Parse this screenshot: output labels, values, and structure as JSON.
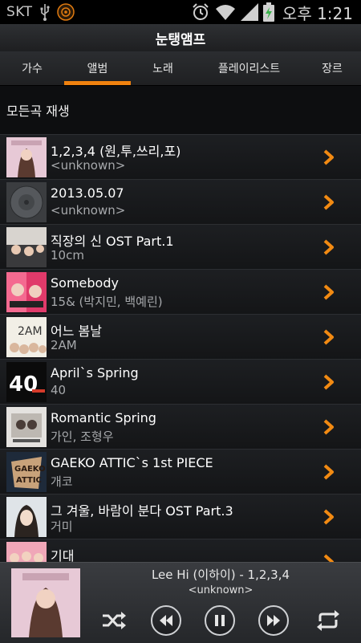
{
  "status_bar": {
    "carrier": "SKT",
    "time": "오후 1:21"
  },
  "app": {
    "title": "눈탱앰프"
  },
  "tabs": [
    {
      "label": "가수"
    },
    {
      "label": "앨범",
      "selected": true
    },
    {
      "label": "노래"
    },
    {
      "label": "플레이리스트"
    },
    {
      "label": "장르"
    }
  ],
  "play_all": {
    "label": "모든곡 재생"
  },
  "albums": [
    {
      "title": "1,2,3,4 (원,투,쓰리,포)",
      "artist": "<unknown>"
    },
    {
      "title": "2013.05.07",
      "artist": "<unknown>"
    },
    {
      "title": "직장의 신 OST Part.1",
      "artist": "10cm"
    },
    {
      "title": "Somebody",
      "artist": "15& (박지민, 백예린)"
    },
    {
      "title": "어느 봄날",
      "artist": "2AM"
    },
    {
      "title": "April`s Spring",
      "artist": "40"
    },
    {
      "title": "Romantic Spring",
      "artist": "가인, 조형우"
    },
    {
      "title": "GAEKO ATTIC`s 1st PIECE",
      "artist": "개코"
    },
    {
      "title": "그 겨울, 바람이 분다 OST Part.3",
      "artist": "거미"
    },
    {
      "title": "기대",
      "artist": ""
    }
  ],
  "now_playing": {
    "title": "Lee Hi (이하이) - 1,2,3,4",
    "artist": "<unknown>"
  },
  "colors": {
    "accent": "#f0820f",
    "background": "#0f1012"
  },
  "icons": [
    "usb-icon",
    "media-icon",
    "alarm-icon",
    "wifi-icon",
    "signal-icon",
    "battery-icon",
    "chevron-right-icon",
    "shuffle-icon",
    "rewind-icon",
    "pause-icon",
    "fast-forward-icon",
    "repeat-icon"
  ]
}
